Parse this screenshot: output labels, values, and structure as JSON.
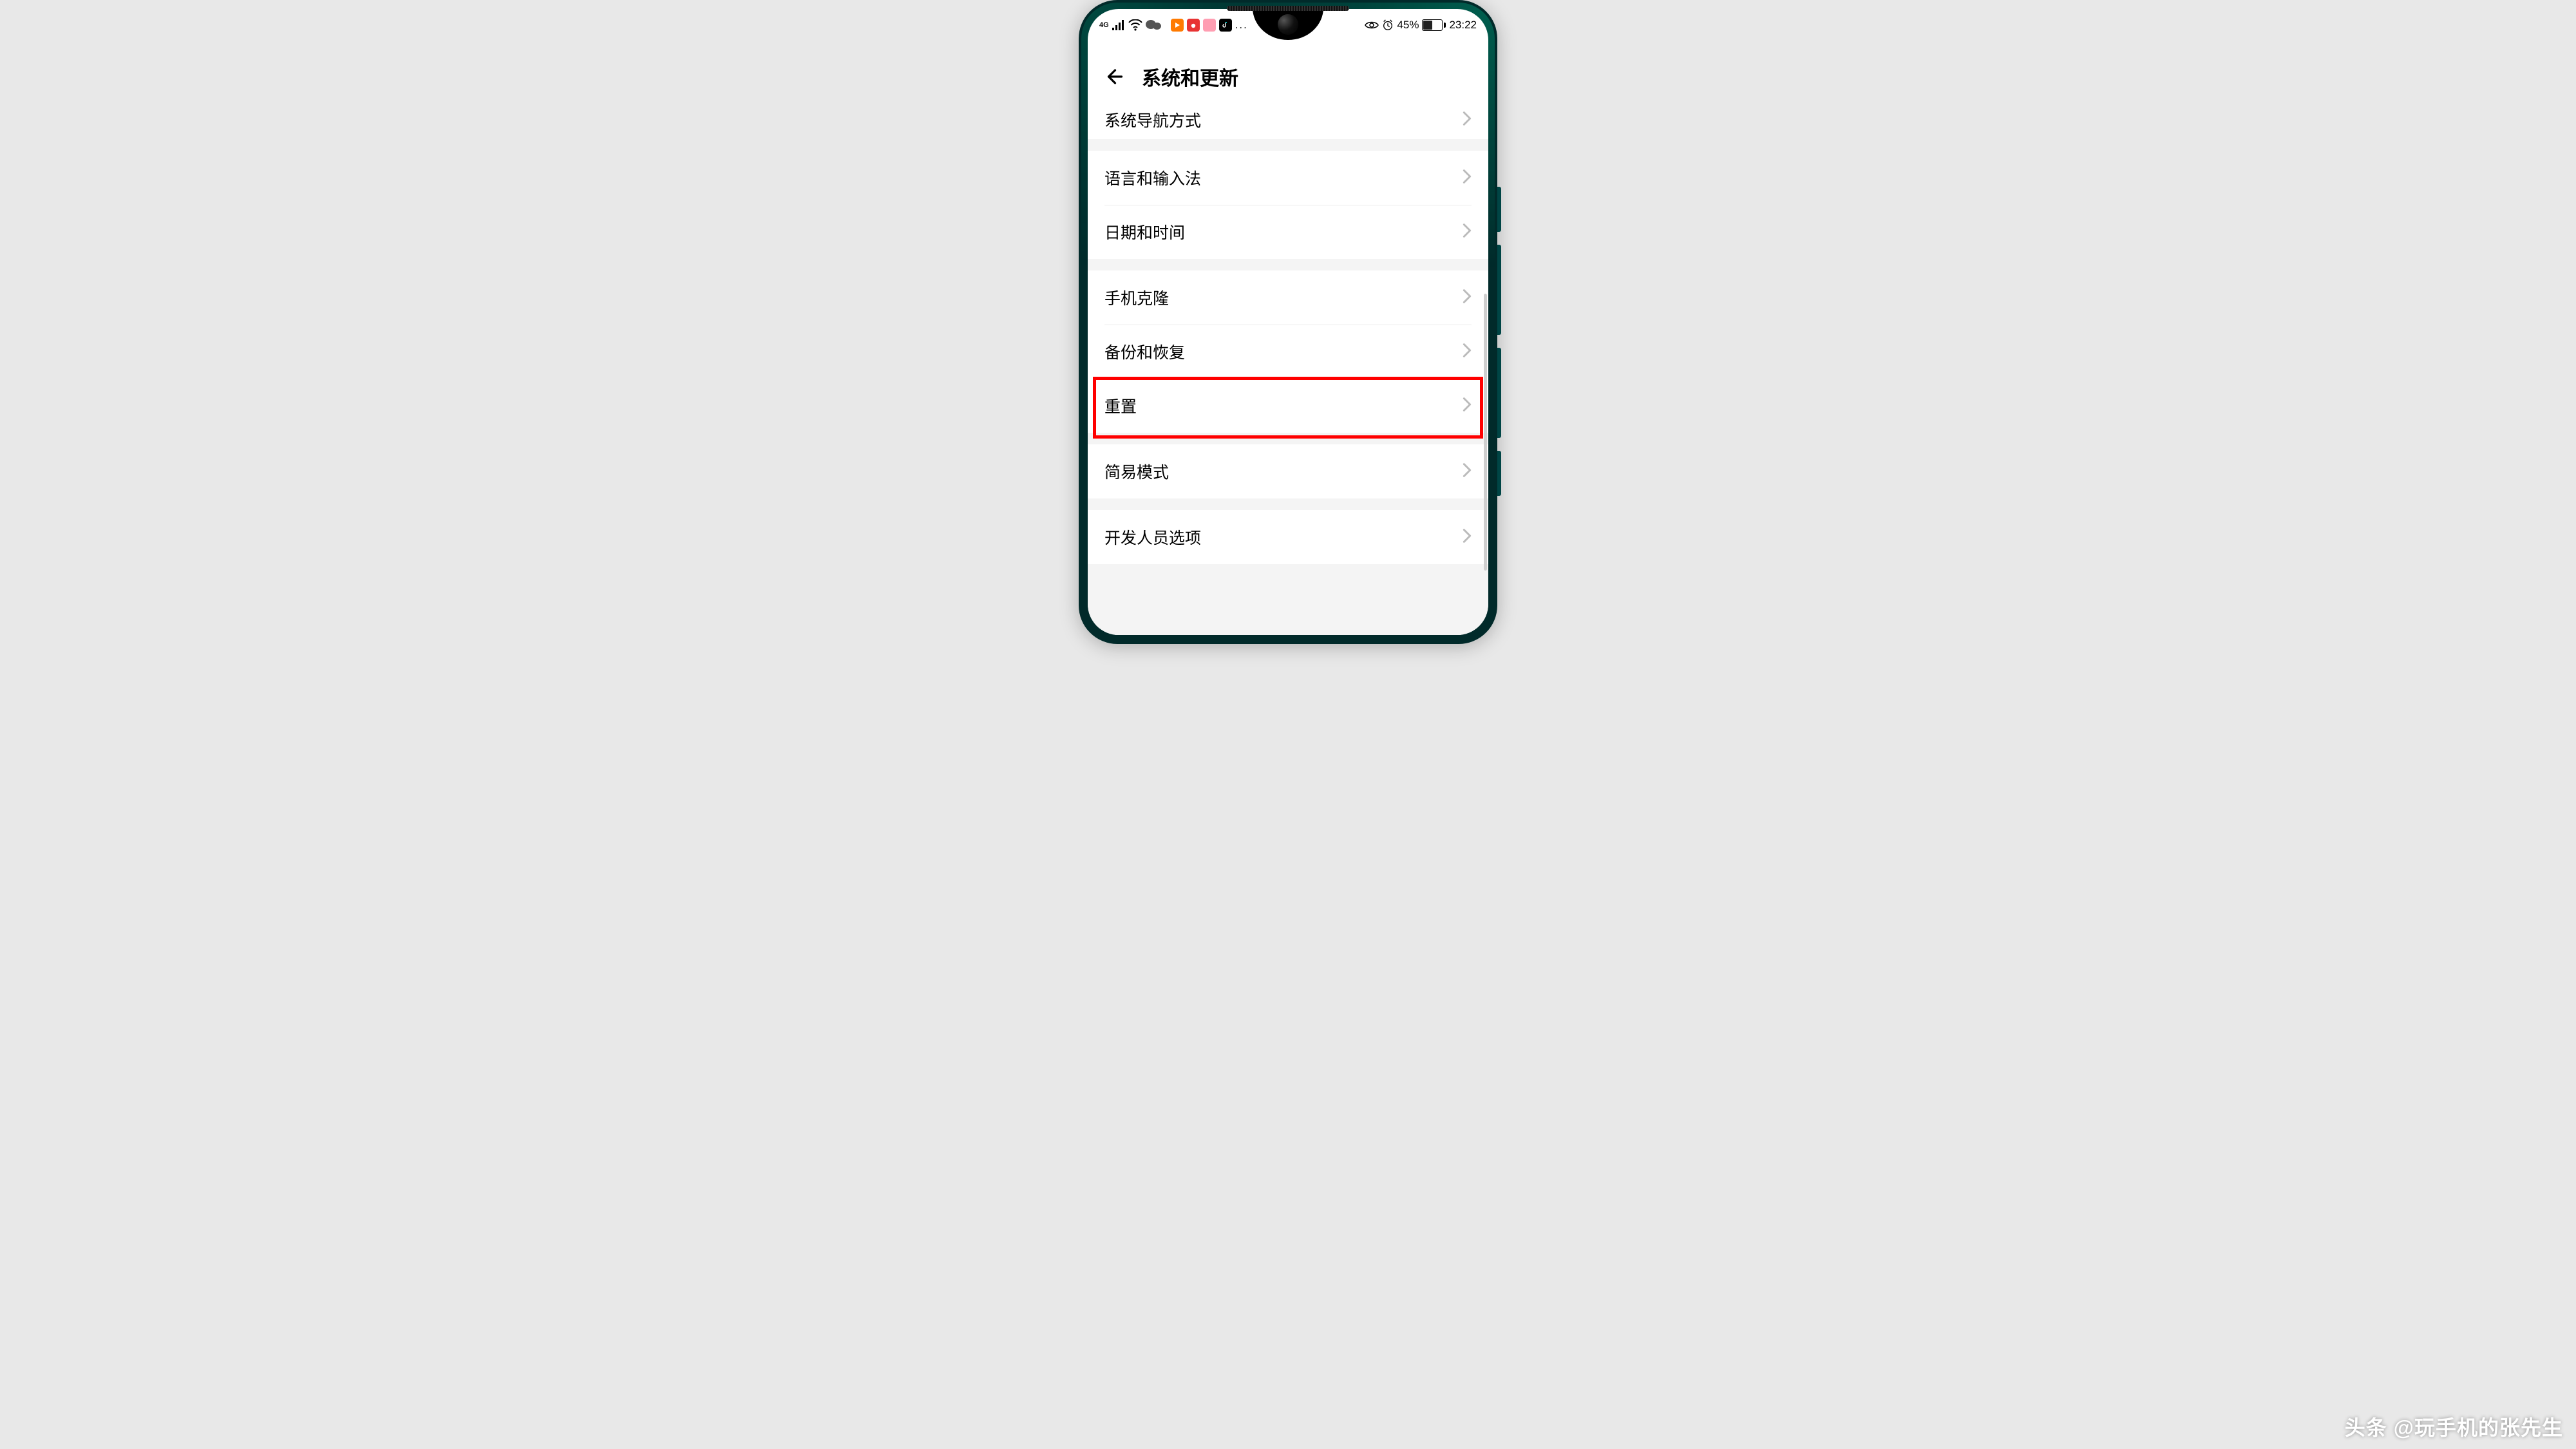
{
  "statusbar": {
    "signal_prefix": "4G",
    "battery_percent": "45%",
    "time": "23:22",
    "more": "..."
  },
  "header": {
    "title": "系统和更新"
  },
  "groups": [
    {
      "rows": [
        {
          "label": "系统导航方式"
        }
      ]
    },
    {
      "rows": [
        {
          "label": "语言和输入法"
        },
        {
          "label": "日期和时间"
        }
      ]
    },
    {
      "rows": [
        {
          "label": "手机克隆"
        },
        {
          "label": "备份和恢复"
        },
        {
          "label": "重置",
          "highlighted": true
        }
      ]
    },
    {
      "rows": [
        {
          "label": "简易模式"
        }
      ]
    },
    {
      "rows": [
        {
          "label": "开发人员选项"
        }
      ]
    }
  ],
  "watermark": {
    "prefix": "头条",
    "handle": "@玩手机的张先生"
  },
  "colors": {
    "highlight": "#ff0000",
    "frame": "#012a2a"
  }
}
